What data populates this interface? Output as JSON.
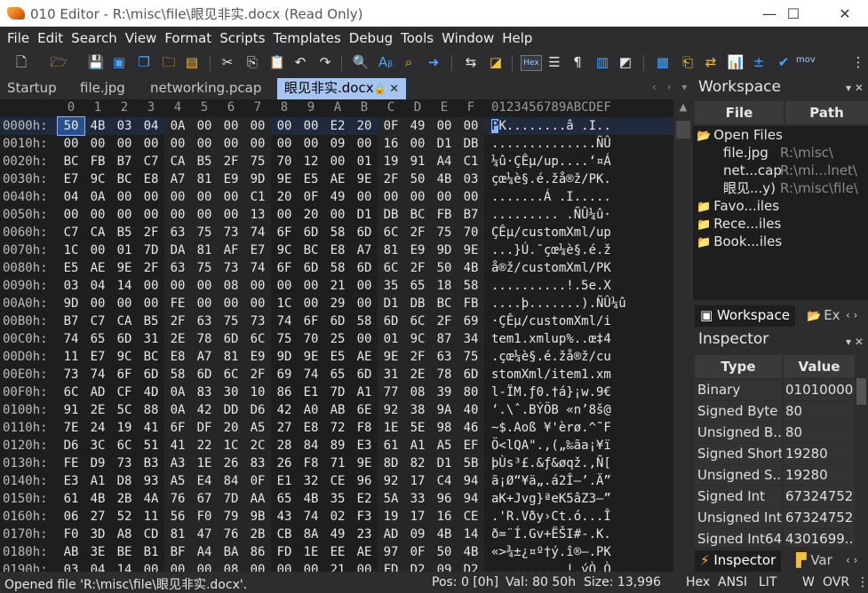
{
  "title_bar": {
    "title": "010 Editor - R:\\misc\\file\\眼见非实.docx (Read Only)",
    "minimize": "—",
    "maximize": "☐",
    "close": "✕"
  },
  "menu": [
    "File",
    "Edit",
    "Search",
    "View",
    "Format",
    "Scripts",
    "Templates",
    "Debug",
    "Tools",
    "Window",
    "Help"
  ],
  "toolbar": {
    "hex_label": "Hex",
    "mov_label": "mov",
    "icons": [
      "new-file-icon",
      "open-folder-icon",
      "save-icon",
      "save-all-icon",
      "copy-window-icon",
      "open-multiple-icon",
      "cut-icon",
      "copy-icon",
      "paste-icon",
      "undo-icon",
      "redo-icon",
      "find-icon",
      "replace-icon",
      "find-in-files-icon",
      "goto-icon",
      "compare-icon",
      "template-icon",
      "hex-mode-icon",
      "edit-mode-icon",
      "paragraph-icon",
      "columns-icon",
      "bookmark-icon",
      "calculator-icon",
      "clipboard-icon",
      "swap-icon",
      "histogram-icon",
      "plus-minus-icon",
      "check-icon",
      "more-icon"
    ]
  },
  "tabs": {
    "items": [
      "Startup",
      "file.jpg",
      "networking.pcap",
      "眼见非实.docx"
    ],
    "active_index": 3,
    "nav": "‹ › ▾"
  },
  "hex_view": {
    "column_headers": [
      "0",
      "1",
      "2",
      "3",
      "4",
      "5",
      "6",
      "7",
      "8",
      "9",
      "A",
      "B",
      "C",
      "D",
      "E",
      "F"
    ],
    "ascii_header": "0123456789ABCDEF",
    "rows": [
      {
        "offset": "0000h:",
        "bytes": [
          "50",
          "4B",
          "03",
          "04",
          "0A",
          "00",
          "00",
          "00",
          "00",
          "00",
          "E2",
          "20",
          "0F",
          "49",
          "00",
          "00"
        ],
        "ascii": "PK........â .I.."
      },
      {
        "offset": "0010h:",
        "bytes": [
          "00",
          "00",
          "00",
          "00",
          "00",
          "00",
          "00",
          "00",
          "00",
          "00",
          "09",
          "00",
          "16",
          "00",
          "D1",
          "DB"
        ],
        "ascii": "..............ÑÛ"
      },
      {
        "offset": "0020h:",
        "bytes": [
          "BC",
          "FB",
          "B7",
          "C7",
          "CA",
          "B5",
          "2F",
          "75",
          "70",
          "12",
          "00",
          "01",
          "19",
          "91",
          "A4",
          "C1"
        ],
        "ascii": "¼û·ÇÊµ/up....‘¤Á"
      },
      {
        "offset": "0030h:",
        "bytes": [
          "E7",
          "9C",
          "BC",
          "E8",
          "A7",
          "81",
          "E9",
          "9D",
          "9E",
          "E5",
          "AE",
          "9E",
          "2F",
          "50",
          "4B",
          "03"
        ],
        "ascii": "çœ¼è§.é.žå®ž/PK."
      },
      {
        "offset": "0040h:",
        "bytes": [
          "04",
          "0A",
          "00",
          "00",
          "00",
          "00",
          "00",
          "C1",
          "20",
          "0F",
          "49",
          "00",
          "00",
          "00",
          "00",
          "00"
        ],
        "ascii": ".......Á .I....."
      },
      {
        "offset": "0050h:",
        "bytes": [
          "00",
          "00",
          "00",
          "00",
          "00",
          "00",
          "00",
          "13",
          "00",
          "20",
          "00",
          "D1",
          "DB",
          "BC",
          "FB",
          "B7"
        ],
        "ascii": "......... .ÑÛ¼û·"
      },
      {
        "offset": "0060h:",
        "bytes": [
          "C7",
          "CA",
          "B5",
          "2F",
          "63",
          "75",
          "73",
          "74",
          "6F",
          "6D",
          "58",
          "6D",
          "6C",
          "2F",
          "75",
          "70"
        ],
        "ascii": "ÇÊµ/customXml/up"
      },
      {
        "offset": "0070h:",
        "bytes": [
          "1C",
          "00",
          "01",
          "7D",
          "DA",
          "81",
          "AF",
          "E7",
          "9C",
          "BC",
          "E8",
          "A7",
          "81",
          "E9",
          "9D",
          "9E"
        ],
        "ascii": "...}Ú.¯çœ¼è§.é.ž"
      },
      {
        "offset": "0080h:",
        "bytes": [
          "E5",
          "AE",
          "9E",
          "2F",
          "63",
          "75",
          "73",
          "74",
          "6F",
          "6D",
          "58",
          "6D",
          "6C",
          "2F",
          "50",
          "4B"
        ],
        "ascii": "å®ž/customXml/PK"
      },
      {
        "offset": "0090h:",
        "bytes": [
          "03",
          "04",
          "14",
          "00",
          "00",
          "00",
          "08",
          "00",
          "00",
          "00",
          "21",
          "00",
          "35",
          "65",
          "18",
          "58"
        ],
        "ascii": "..........!.5e.X"
      },
      {
        "offset": "00A0h:",
        "bytes": [
          "9D",
          "00",
          "00",
          "00",
          "FE",
          "00",
          "00",
          "00",
          "1C",
          "00",
          "29",
          "00",
          "D1",
          "DB",
          "BC",
          "FB"
        ],
        "ascii": "....þ.......).ÑÛ¼û"
      },
      {
        "offset": "00B0h:",
        "bytes": [
          "B7",
          "C7",
          "CA",
          "B5",
          "2F",
          "63",
          "75",
          "73",
          "74",
          "6F",
          "6D",
          "58",
          "6D",
          "6C",
          "2F",
          "69"
        ],
        "ascii": "·ÇÊµ/customXml/i"
      },
      {
        "offset": "00C0h:",
        "bytes": [
          "74",
          "65",
          "6D",
          "31",
          "2E",
          "78",
          "6D",
          "6C",
          "75",
          "70",
          "25",
          "00",
          "01",
          "9C",
          "87",
          "34"
        ],
        "ascii": "tem1.xmlup%..œ‡4"
      },
      {
        "offset": "00D0h:",
        "bytes": [
          "11",
          "E7",
          "9C",
          "BC",
          "E8",
          "A7",
          "81",
          "E9",
          "9D",
          "9E",
          "E5",
          "AE",
          "9E",
          "2F",
          "63",
          "75"
        ],
        "ascii": ".çœ¼è§.é.žå®ž/cu"
      },
      {
        "offset": "00E0h:",
        "bytes": [
          "73",
          "74",
          "6F",
          "6D",
          "58",
          "6D",
          "6C",
          "2F",
          "69",
          "74",
          "65",
          "6D",
          "31",
          "2E",
          "78",
          "6D"
        ],
        "ascii": "stomXml/item1.xm"
      },
      {
        "offset": "00F0h:",
        "bytes": [
          "6C",
          "AD",
          "CF",
          "4D",
          "0A",
          "83",
          "30",
          "10",
          "86",
          "E1",
          "7D",
          "A1",
          "77",
          "08",
          "39",
          "80"
        ],
        "ascii": "l-ÏM.ƒ0.†á}¡w.9€"
      },
      {
        "offset": "0100h:",
        "bytes": [
          "91",
          "2E",
          "5C",
          "88",
          "0A",
          "42",
          "DD",
          "D6",
          "42",
          "A0",
          "AB",
          "6E",
          "92",
          "38",
          "9A",
          "40"
        ],
        "ascii": "‘.\\ˆ.BÝÖB «n’8š@"
      },
      {
        "offset": "0110h:",
        "bytes": [
          "7E",
          "24",
          "19",
          "41",
          "6F",
          "DF",
          "20",
          "A5",
          "27",
          "E8",
          "72",
          "F8",
          "1E",
          "5E",
          "98",
          "46"
        ],
        "ascii": "~$.Aoß ¥'èrø.^˜F"
      },
      {
        "offset": "0120h:",
        "bytes": [
          "D6",
          "3C",
          "6C",
          "51",
          "41",
          "22",
          "1C",
          "2C",
          "28",
          "84",
          "89",
          "E3",
          "61",
          "A1",
          "A5",
          "EF"
        ],
        "ascii": "Ö<lQA\".,(„‰ãa¡¥ï"
      },
      {
        "offset": "0130h:",
        "bytes": [
          "FE",
          "D9",
          "73",
          "B3",
          "A3",
          "1E",
          "26",
          "83",
          "26",
          "F8",
          "71",
          "9E",
          "8D",
          "82",
          "D1",
          "5B"
        ],
        "ascii": "þÙs³£.&ƒ&øqž.‚Ñ["
      },
      {
        "offset": "0140h:",
        "bytes": [
          "E3",
          "A1",
          "D8",
          "93",
          "A5",
          "E4",
          "84",
          "0F",
          "E1",
          "32",
          "CE",
          "96",
          "92",
          "17",
          "C4",
          "94"
        ],
        "ascii": "ã¡Ø“¥ä„.á2Î–’.Ä”"
      },
      {
        "offset": "0150h:",
        "bytes": [
          "61",
          "4B",
          "2B",
          "4A",
          "76",
          "67",
          "7D",
          "AA",
          "65",
          "4B",
          "35",
          "E2",
          "5A",
          "33",
          "96",
          "94"
        ],
        "ascii": "aK+Jvg}ªeK5âZ3–”"
      },
      {
        "offset": "0160h:",
        "bytes": [
          "06",
          "27",
          "52",
          "11",
          "56",
          "F0",
          "79",
          "9B",
          "43",
          "74",
          "02",
          "F3",
          "19",
          "17",
          "16",
          "CE"
        ],
        "ascii": ".'R.Vðy›Ct.ó...Î"
      },
      {
        "offset": "0170h:",
        "bytes": [
          "F0",
          "3D",
          "A8",
          "CD",
          "81",
          "47",
          "76",
          "2B",
          "CB",
          "8A",
          "49",
          "23",
          "AD",
          "09",
          "4B",
          "14"
        ],
        "ascii": "ð=¨Í.Gv+ËŠI#-.K."
      },
      {
        "offset": "0180h:",
        "bytes": [
          "AB",
          "3E",
          "BE",
          "B1",
          "BF",
          "A4",
          "BA",
          "86",
          "FD",
          "1E",
          "EE",
          "AE",
          "97",
          "0F",
          "50",
          "4B"
        ],
        "ascii": "«>¾±¿¤º†ý.î®—.PK"
      },
      {
        "offset": "0190h:",
        "bytes": [
          "03",
          "04",
          "14",
          "00",
          "00",
          "00",
          "08",
          "00",
          "00",
          "00",
          "21",
          "00",
          "FD",
          "D2",
          "09",
          "D2"
        ],
        "ascii": "..........!.ýÒ.Ò"
      }
    ]
  },
  "workspace": {
    "title": "Workspace",
    "col_file": "File",
    "col_path": "Path",
    "tree": [
      {
        "label": "Open Files",
        "path": "",
        "type": "folder"
      },
      {
        "label": "file.jpg",
        "path": "R:\\misc\\",
        "type": "file"
      },
      {
        "label": "net...cap",
        "path": "R:\\mi...lnet\\",
        "type": "file"
      },
      {
        "label": "眼见...y)",
        "path": "R:\\misc\\file\\",
        "type": "file"
      },
      {
        "label": "Favo...iles",
        "path": "",
        "type": "folder"
      },
      {
        "label": "Rece...iles",
        "path": "",
        "type": "folder"
      },
      {
        "label": "Book...iles",
        "path": "",
        "type": "folder"
      }
    ],
    "tabs": [
      "Workspace",
      "Ex"
    ]
  },
  "inspector": {
    "title": "Inspector",
    "col_type": "Type",
    "col_value": "Value",
    "rows": [
      {
        "type": "Binary",
        "value": "01010000"
      },
      {
        "type": "Signed Byte",
        "value": "80"
      },
      {
        "type": "Unsigned B...",
        "value": "80"
      },
      {
        "type": "Signed Short",
        "value": "19280"
      },
      {
        "type": "Unsigned S...",
        "value": "19280"
      },
      {
        "type": "Signed Int",
        "value": "67324752"
      },
      {
        "type": "Unsigned Int",
        "value": "67324752"
      },
      {
        "type": "Signed Int64",
        "value": "4301699..."
      }
    ],
    "bottom_tabs": [
      "Inspector",
      "Var"
    ]
  },
  "status": {
    "message": "Opened file 'R:\\misc\\file\\眼见非实.docx'.",
    "pos": "Pos: 0 [0h]",
    "val": "Val: 80 50h",
    "size": "Size: 13,996",
    "mode": "Hex",
    "charset": "ANSI",
    "endian": "LIT",
    "w": "W",
    "ovr": "OVR",
    "grip": "⋮"
  }
}
